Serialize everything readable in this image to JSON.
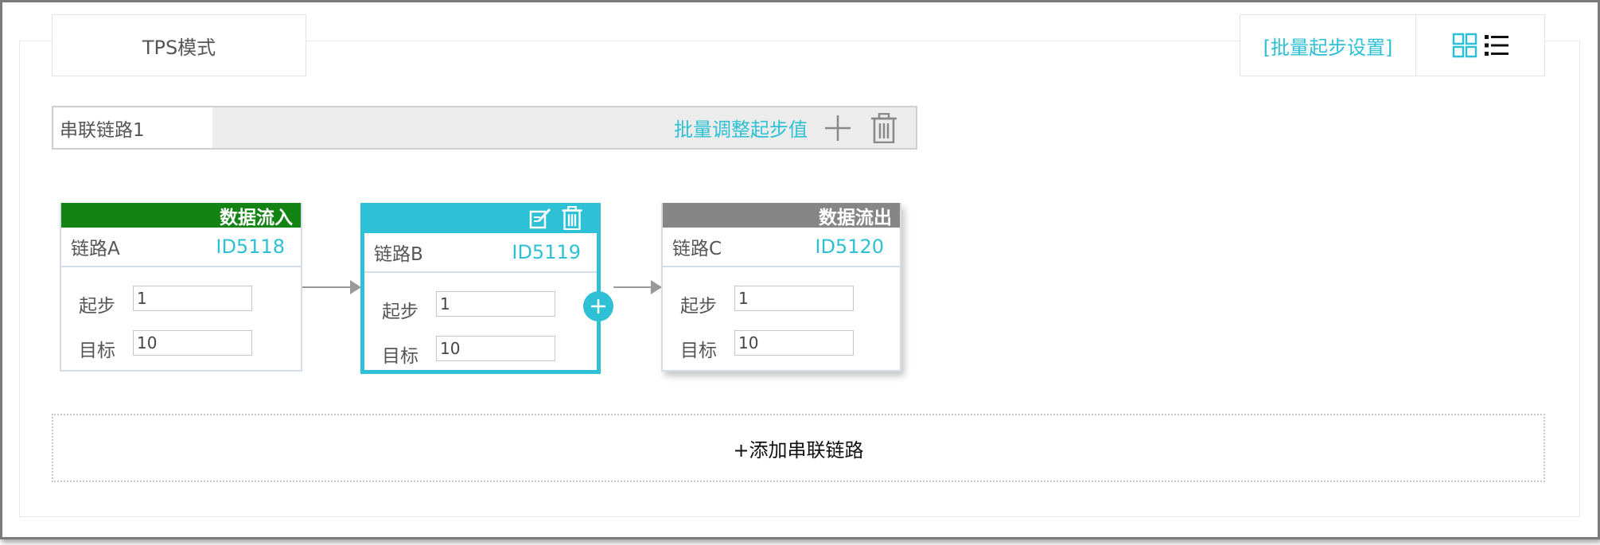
{
  "colors": {
    "accent": "#2ec0d5",
    "data_in": "#138314",
    "data_out": "#868686"
  },
  "header": {
    "mode_tab_label": "TPS模式",
    "batch_start_link": "[批量起步设置]",
    "grid_view_icon": "grid-view-icon",
    "list_view_icon": "list-view-icon"
  },
  "chain": {
    "name": "串联链路1",
    "batch_adjust_label": "批量调整起步值",
    "add_icon": "plus-icon",
    "delete_icon": "trash-icon"
  },
  "nodes": [
    {
      "header_label": "数据流入",
      "name": "链路A",
      "id": "ID5118",
      "start_label": "起步",
      "start_value": "1",
      "target_label": "目标",
      "target_value": "10"
    },
    {
      "header_label": "",
      "name": "链路B",
      "id": "ID5119",
      "start_label": "起步",
      "start_value": "1",
      "target_label": "目标",
      "target_value": "10",
      "edit_icon": "edit-icon",
      "delete_icon": "trash-icon"
    },
    {
      "header_label": "数据流出",
      "name": "链路C",
      "id": "ID5120",
      "start_label": "起步",
      "start_value": "1",
      "target_label": "目标",
      "target_value": "10"
    }
  ],
  "add_chain_label": "+添加串联链路"
}
